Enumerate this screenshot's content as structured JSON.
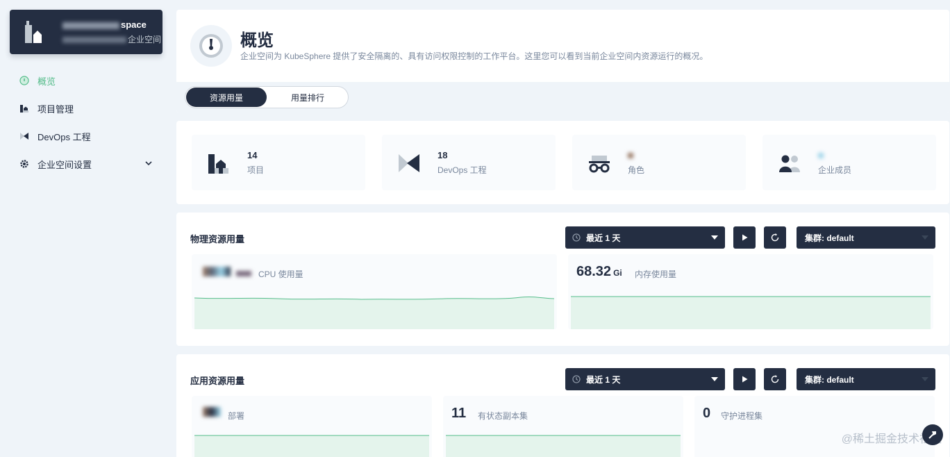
{
  "workspace": {
    "name": "space",
    "sub": "企业空间"
  },
  "nav": [
    {
      "label": "概览",
      "icon": "dashboard-icon",
      "active": true
    },
    {
      "label": "项目管理",
      "icon": "project-icon"
    },
    {
      "label": "DevOps 工程",
      "icon": "devops-icon"
    },
    {
      "label": "企业空间设置",
      "icon": "gear-icon"
    }
  ],
  "header": {
    "title": "概览",
    "description": "企业空间为 KubeSphere 提供了安全隔离的、具有访问权限控制的工作平台。这里您可以看到当前企业空间内资源运行的概况。",
    "tabs": [
      "资源用量",
      "用量排行"
    ]
  },
  "stats": [
    {
      "value": "14",
      "label": "项目",
      "icon": "project-icon"
    },
    {
      "value": "18",
      "label": "DevOps 工程",
      "icon": "devops-icon"
    },
    {
      "value": "",
      "label": "角色",
      "icon": "role-icon"
    },
    {
      "value": "",
      "label": "企业成员",
      "icon": "members-icon"
    }
  ],
  "physical": {
    "title": "物理资源用量",
    "time_range": "最近 1 天",
    "cluster": "集群: default",
    "cpu": {
      "value": "",
      "label": "CPU 使用量"
    },
    "memory": {
      "value": "68.32",
      "unit": "Gi",
      "label": "内存使用量"
    }
  },
  "app": {
    "title": "应用资源用量",
    "time_range": "最近 1 天",
    "cluster": "集群: default",
    "deployments": {
      "value": "",
      "label": "部署"
    },
    "statefulsets": {
      "value": "11",
      "label": "有状态副本集"
    },
    "daemonsets": {
      "value": "0",
      "label": "守护进程集"
    }
  },
  "watermark": "@稀土掘金技术社区",
  "colors": {
    "accent": "#55bc8a",
    "dark": "#242e42",
    "muted": "#79879c"
  }
}
